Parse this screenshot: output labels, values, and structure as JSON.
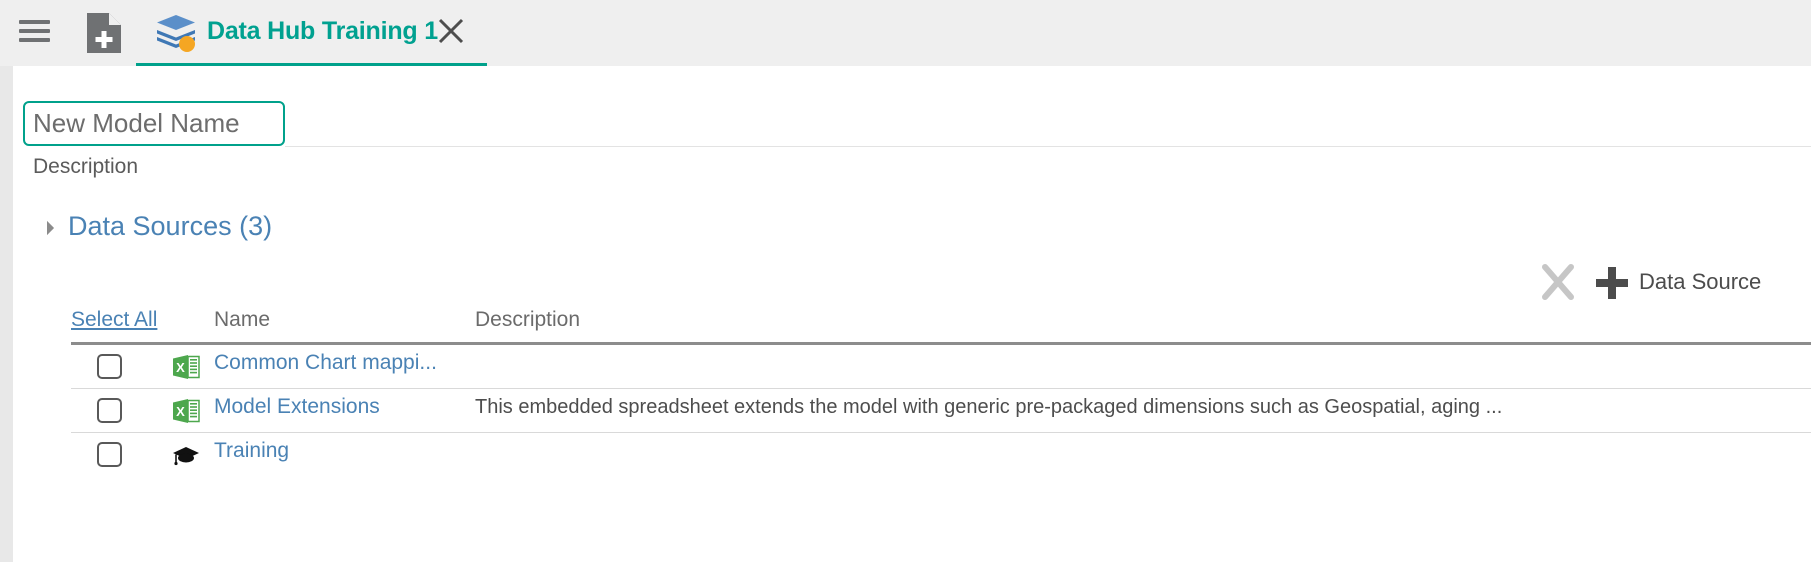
{
  "header": {
    "menu_icon": "hamburger-menu-icon",
    "new_document_icon": "new-document-icon",
    "tab": {
      "icon": "data-hub-layers-icon",
      "label": "Data Hub Training 1",
      "close_icon": "close-icon",
      "active_color": "#00a18b"
    }
  },
  "form": {
    "model_name_value": "",
    "model_name_placeholder": "New Model Name",
    "description_label": "Description"
  },
  "section": {
    "caret_icon": "triangle-collapse-icon",
    "title": "Data Sources (3)",
    "title_color": "#4a82b4"
  },
  "toolbar": {
    "delete_icon": "x-delete-icon",
    "add_icon": "plus-icon",
    "add_label": "Data Source"
  },
  "table": {
    "columns": {
      "select_all": "Select All",
      "name": "Name",
      "description": "Description"
    },
    "rows": [
      {
        "checked": false,
        "icon": "excel-spreadsheet-icon",
        "name": "Common Chart mappi...",
        "description": ""
      },
      {
        "checked": false,
        "icon": "excel-spreadsheet-icon",
        "name": "Model Extensions",
        "description": "This embedded spreadsheet extends the model with generic pre-packaged dimensions such as Geospatial, aging ..."
      },
      {
        "checked": false,
        "icon": "graduation-cap-icon",
        "name": "Training",
        "description": ""
      }
    ]
  }
}
